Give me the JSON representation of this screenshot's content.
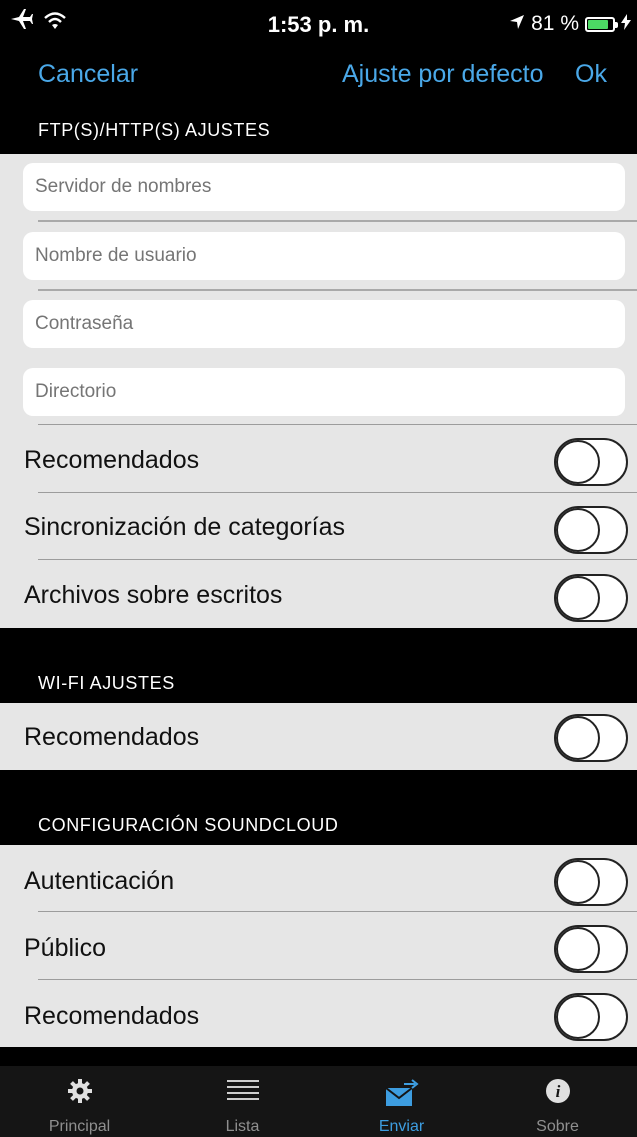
{
  "status_bar": {
    "time": "1:53 p. m.",
    "battery_text": "81 %",
    "battery_level": 0.81,
    "icons": [
      "airplane-icon",
      "wifi-icon",
      "location-arrow-icon",
      "battery-icon",
      "charging-icon"
    ]
  },
  "nav": {
    "cancel": "Cancelar",
    "default": "Ajuste por defecto",
    "ok": "Ok",
    "accent_color": "#4aa8e8"
  },
  "ftp": {
    "header": "FTP(S)/HTTP(S) AJUSTES",
    "server_placeholder": "Servidor de nombres",
    "user_placeholder": "Nombre de usuario",
    "password_placeholder": "Contraseña",
    "directory_placeholder": "Directorio",
    "recommended": "Recomendados",
    "category_sync": "Sincronización de categorías",
    "overwrite_files": "Archivos sobre escritos"
  },
  "wifi": {
    "header": "WI-FI AJUSTES",
    "recommended": "Recomendados"
  },
  "soundcloud": {
    "header": "CONFIGURACIÓN SOUNDCLOUD",
    "auth": "Autenticación",
    "public": "Público",
    "recommended": "Recomendados"
  },
  "toggles": {
    "ftp_recommended": false,
    "ftp_category_sync": false,
    "ftp_overwrite": false,
    "wifi_recommended": false,
    "sc_auth": false,
    "sc_public": false,
    "sc_recommended": false
  },
  "tabs": [
    {
      "label": "Principal",
      "icon": "gear-icon",
      "active": false
    },
    {
      "label": "Lista",
      "icon": "list-icon",
      "active": false
    },
    {
      "label": "Enviar",
      "icon": "send-mail-icon",
      "active": true
    },
    {
      "label": "Sobre",
      "icon": "info-icon",
      "active": false
    }
  ]
}
